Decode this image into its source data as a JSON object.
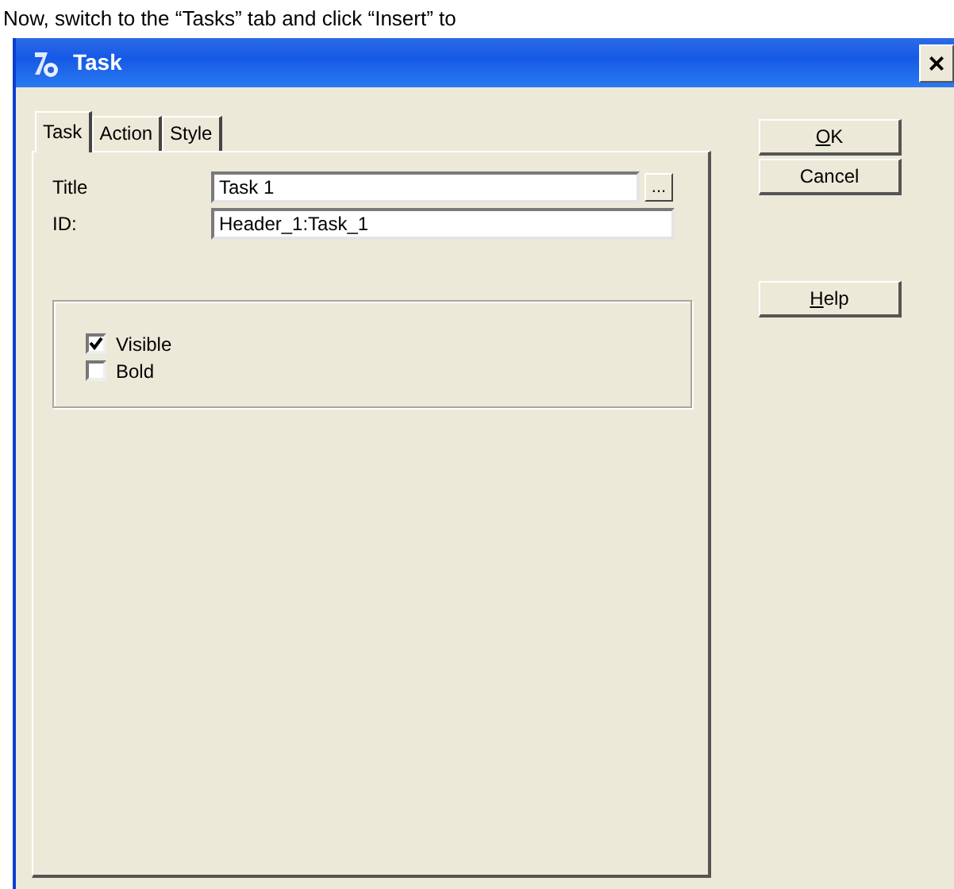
{
  "caption": "Now, switch to the “Tasks” tab and click “Insert” to",
  "window": {
    "title": "Task",
    "close": "×"
  },
  "tabs": [
    {
      "label": "Task",
      "selected": true
    },
    {
      "label": "Action",
      "selected": false
    },
    {
      "label": "Style",
      "selected": false
    }
  ],
  "fields": [
    {
      "label": "Title",
      "value": "Task 1",
      "browse": "..."
    },
    {
      "label": "ID:",
      "value": "Header_1:Task_1"
    }
  ],
  "options": [
    {
      "label": "Visible",
      "checked": true
    },
    {
      "label": "Bold",
      "checked": false
    }
  ],
  "buttons": [
    {
      "label": "OK",
      "underline_first": true
    },
    {
      "label": "Cancel",
      "underline_first": false
    },
    {
      "label": "Help",
      "underline_first": true
    }
  ]
}
